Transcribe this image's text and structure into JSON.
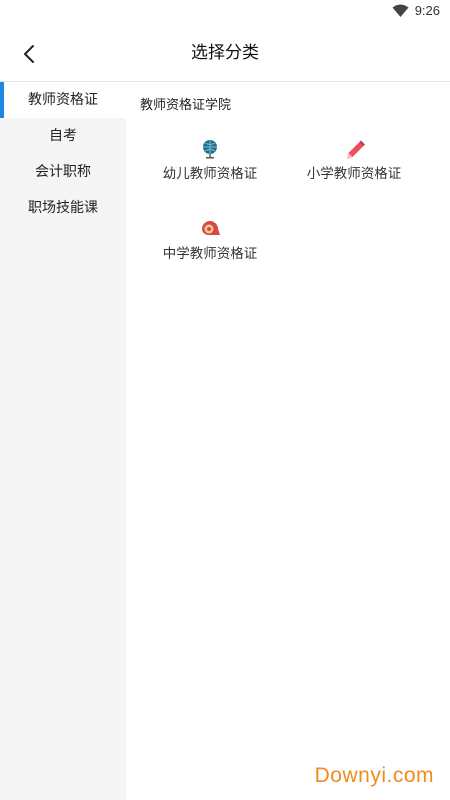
{
  "status_bar": {
    "time": "9:26",
    "wifi_icon": "wifi-icon"
  },
  "header": {
    "title": "选择分类",
    "back_icon": "back-arrow-icon"
  },
  "sidebar": {
    "items": [
      {
        "label": "教师资格证",
        "active": true
      },
      {
        "label": "自考",
        "active": false
      },
      {
        "label": "会计职称",
        "active": false
      },
      {
        "label": "职场技能课",
        "active": false
      }
    ]
  },
  "main": {
    "section_title": "教师资格证学院",
    "cards": [
      {
        "label": "幼儿教师资格证",
        "icon": "globe-icon",
        "icon_color": "#1f6f8b"
      },
      {
        "label": "小学教师资格证",
        "icon": "pencil-icon",
        "icon_color": "#ec4f5f"
      },
      {
        "label": "中学教师资格证",
        "icon": "tape-icon",
        "icon_color": "#d9483b"
      }
    ]
  },
  "watermark": "Downyi.com",
  "colors": {
    "accent": "#1e88e5",
    "sidebar_bg": "#f5f5f5",
    "watermark": "#f28a1c"
  }
}
